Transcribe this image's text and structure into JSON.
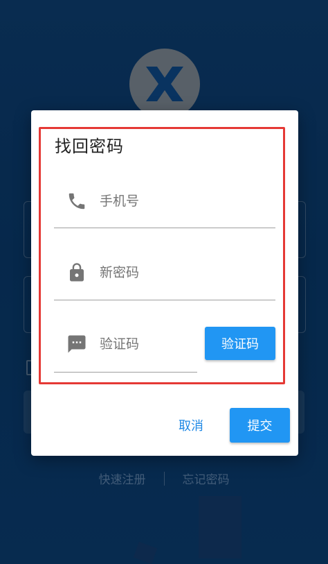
{
  "background": {
    "links": {
      "register": "快速注册",
      "forgot": "忘记密码"
    }
  },
  "dialog": {
    "title": "找回密码",
    "fields": {
      "phone": {
        "placeholder": "手机号",
        "icon": "phone-icon"
      },
      "new_password": {
        "placeholder": "新密码",
        "icon": "lock-icon"
      },
      "code": {
        "placeholder": "验证码",
        "icon": "message-icon"
      }
    },
    "get_code_label": "验证码",
    "cancel_label": "取消",
    "submit_label": "提交"
  },
  "colors": {
    "accent": "#2196f3",
    "highlight": "#e53935",
    "background": "#0d3f73"
  }
}
